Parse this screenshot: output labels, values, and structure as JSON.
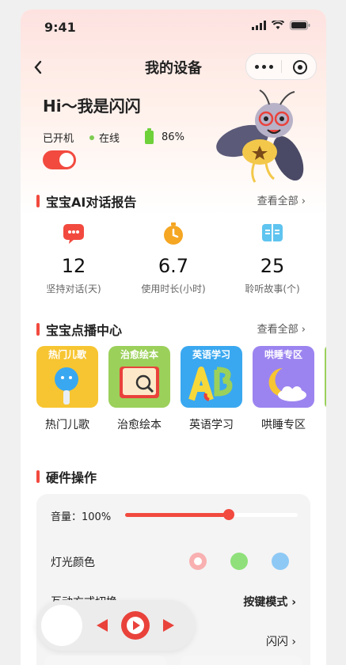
{
  "status": {
    "time": "9:41"
  },
  "nav": {
    "title": "我的设备"
  },
  "hero": {
    "greeting": "Hi～我是闪闪",
    "power_status": "已开机",
    "online_status": "在线",
    "battery": "86%"
  },
  "report": {
    "title": "宝宝AI对话报告",
    "see_all": "查看全部 ›",
    "stats": [
      {
        "value": "12",
        "label": "坚持对话(天)",
        "icon": "chat-bubble-icon"
      },
      {
        "value": "6.7",
        "label": "使用时长(小时)",
        "icon": "timer-icon"
      },
      {
        "value": "25",
        "label": "聆听故事(个)",
        "icon": "book-icon"
      }
    ]
  },
  "vod": {
    "title": "宝宝点播中心",
    "see_all": "查看全部 ›",
    "items": [
      {
        "tag": "热门儿歌",
        "label": "热门儿歌",
        "color": "#f7c531"
      },
      {
        "tag": "治愈绘本",
        "label": "治愈绘本",
        "color": "#9bd05a"
      },
      {
        "tag": "英语学习",
        "label": "英语学习",
        "color": "#3aa8f0"
      },
      {
        "tag": "哄睡专区",
        "label": "哄睡专区",
        "color": "#9c84f0"
      }
    ]
  },
  "hardware": {
    "title": "硬件操作",
    "volume_label": "音量：100%",
    "volume_level": 0.6,
    "light_label": "灯光颜色",
    "light_colors": [
      "#f9b0b0",
      "#8fe07a",
      "#8ec9f5"
    ],
    "mode_label": "互动方式切换",
    "mode_value": "按键模式 ›",
    "name_value": "闪闪 ›"
  }
}
